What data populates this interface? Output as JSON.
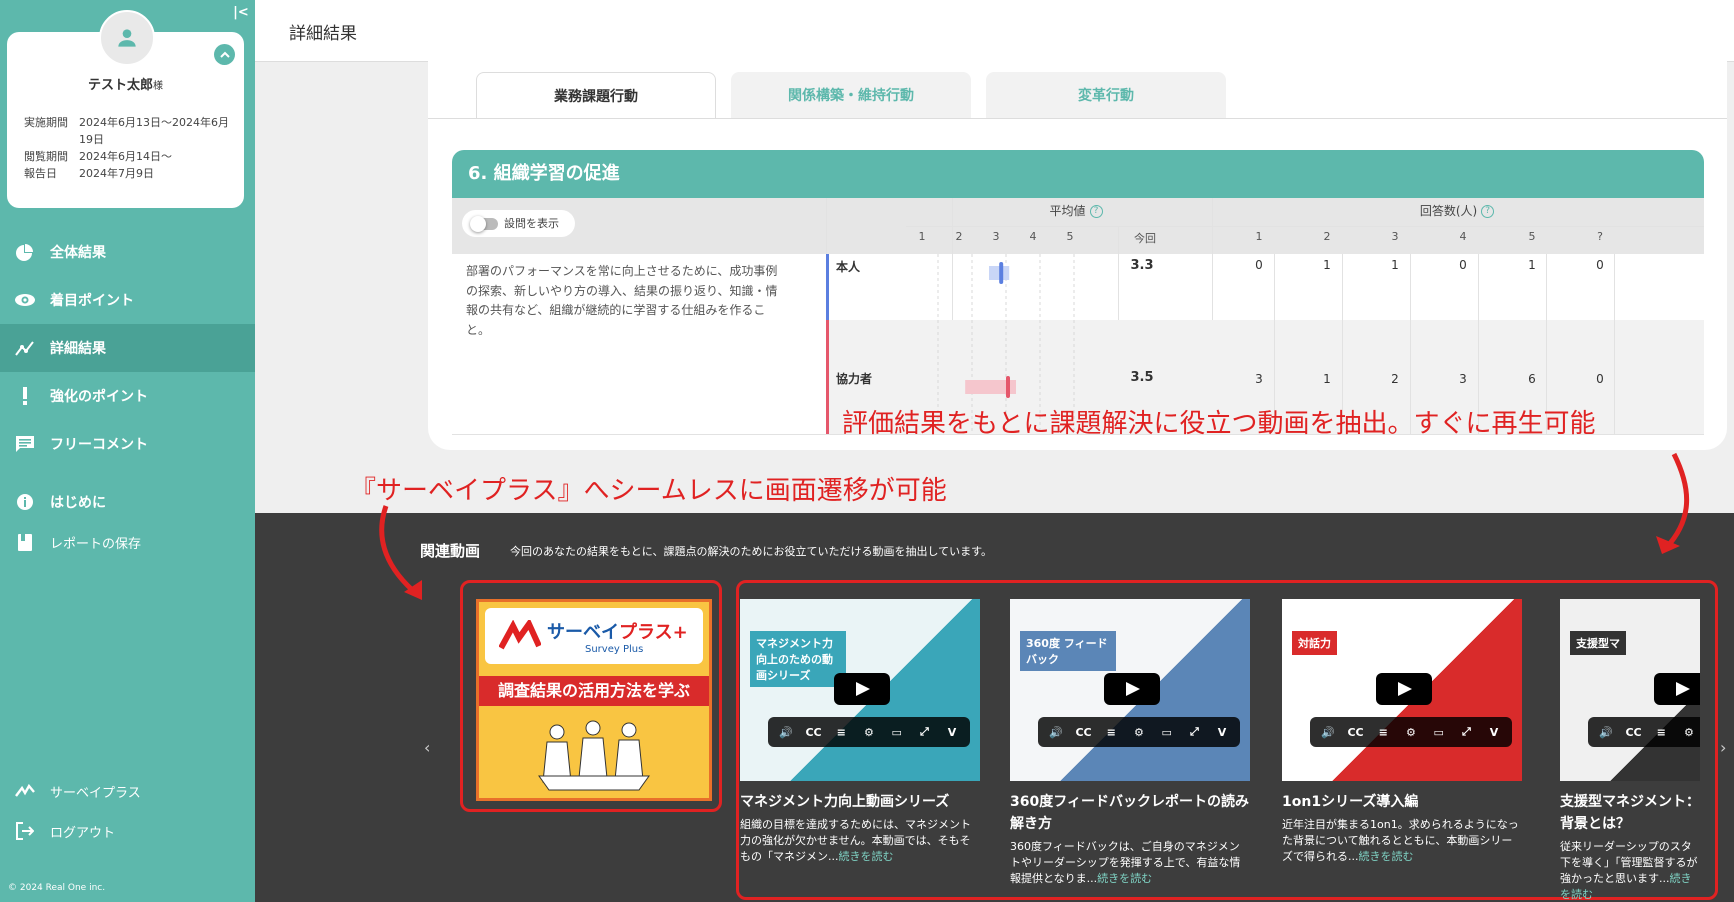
{
  "sidebar": {
    "user_name": "テスト太郎",
    "honorific": "様",
    "periods": [
      {
        "label": "実施期間",
        "value": "2024年6月13日〜2024年6月19日"
      },
      {
        "label": "閲覧期間",
        "value": "2024年6月14日〜"
      },
      {
        "label": "報告日",
        "value": "2024年7月9日"
      }
    ],
    "nav": [
      {
        "label": "全体結果",
        "icon": "pie-chart-icon"
      },
      {
        "label": "着目ポイント",
        "icon": "eye-icon"
      },
      {
        "label": "詳細結果",
        "icon": "analytics-icon",
        "active": true
      },
      {
        "label": "強化のポイント",
        "icon": "exclamation-icon"
      },
      {
        "label": "フリーコメント",
        "icon": "comment-icon"
      }
    ],
    "nav2": [
      {
        "label": "はじめに",
        "icon": "info-icon"
      },
      {
        "label": "レポートの保存",
        "icon": "book-icon"
      }
    ],
    "nav3": [
      {
        "label": "サーベイプラス",
        "icon": "survey-plus-icon"
      },
      {
        "label": "ログアウト",
        "icon": "logout-icon"
      }
    ],
    "copyright": "© 2024 Real One inc."
  },
  "header": {
    "title": "詳細結果"
  },
  "tabs": [
    {
      "label": "業務課題行動",
      "active": true
    },
    {
      "label": "関係構築・維持行動"
    },
    {
      "label": "変革行動"
    }
  ],
  "section": {
    "title": "6. 組織学習の促進",
    "show_question_label": "設問を表示",
    "avg_label": "平均値",
    "count_label": "回答数(人)",
    "scale": [
      "1",
      "2",
      "3",
      "4",
      "5"
    ],
    "current_label": "今回",
    "count_cols": [
      "1",
      "2",
      "3",
      "4",
      "5",
      "?"
    ],
    "description": "部署のパフォーマンスを常に向上させるために、成功事例の探索、新しいやり方の導入、結果の振り返り、知識・情報の共有など、組織が継続的に学習する仕組みを作ること。",
    "rows": [
      {
        "label": "本人",
        "avg": "3.3",
        "counts": [
          "0",
          "1",
          "1",
          "0",
          "1",
          "0"
        ],
        "color": "#5b7fe0",
        "bar_color": "#c9d6f7",
        "avg_value": 3.3,
        "bar_from": 3.0
      },
      {
        "label": "協力者",
        "avg": "3.5",
        "counts": [
          "3",
          "1",
          "2",
          "3",
          "6",
          "0"
        ],
        "color": "#e5576b",
        "bar_color": "#f5c6cd",
        "avg_value": 3.5,
        "bar_from": 2.3
      }
    ]
  },
  "annotations": {
    "right": "評価結果をもとに課題解決に役立つ動画を抽出。すぐに再生可能",
    "left": "『サーベイプラス』へシームレスに画面遷移が可能"
  },
  "videos_section": {
    "title": "関連動画",
    "subtitle": "今回のあなたの結果をもとに、課題点の解決のためにお役立ていただける動画を抽出しています。",
    "promo": {
      "logo_text": "サーベイ",
      "logo_text2": "プラス",
      "logo_sub": "Survey Plus",
      "band": "調査結果の活用方法を学ぶ"
    },
    "more_label": "続きを読む",
    "videos": [
      {
        "title": "マネジメント力向上動画シリーズ",
        "desc": "組織の目標を達成するためには、マネジメント力の強化が欠かせません。本動画では、そもそもの「マネジメン...",
        "thumb_caption": "マネジメント力向上のための動画シリーズ"
      },
      {
        "title": "360度フィードバックレポートの読み解き方",
        "desc": "360度フィードバックは、ご自身のマネジメントやリーダーシップを発揮する上で、有益な情報提供となりま...",
        "thumb_caption": "360度 フィードバック"
      },
      {
        "title": "1on1シリーズ導入編",
        "desc": "近年注目が集まる1on1。求められるようになった背景について触れるとともに、本動画シリーズで得られる...",
        "thumb_caption": "対話力"
      },
      {
        "title": "支援型マネジメント：背景とは？",
        "desc": "従来リーダーシップのスタ下を導く」「管理監督するが強かったと思います...",
        "thumb_caption": "支援型マ"
      }
    ]
  }
}
